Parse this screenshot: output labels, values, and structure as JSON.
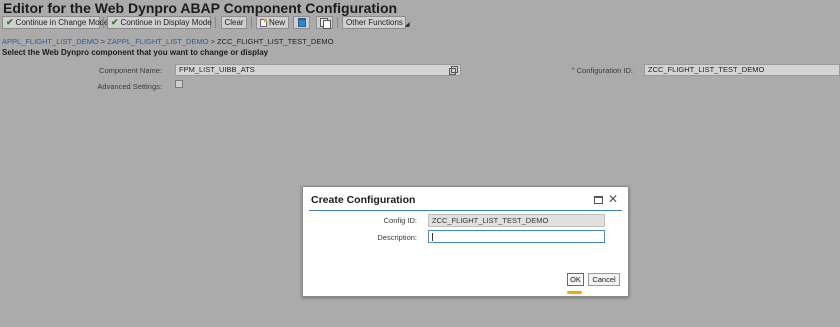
{
  "window": {
    "title": "Editor for the Web Dynpro ABAP Component Configuration"
  },
  "toolbar": {
    "change_mode": "Continue in Change Mode",
    "display_mode": "Continue in Display Mode",
    "clear": "Clear",
    "new": "New",
    "other_functions": "Other Functions",
    "icons": [
      "checkmark-icon",
      "checkmark-icon",
      "new-document-icon",
      "delete-icon",
      "copy-icon"
    ]
  },
  "breadcrumb": {
    "items": [
      "APPL_FLIGHT_LIST_DEMO",
      "ZAPPL_FLIGHT_LIST_DEMO",
      "ZCC_FLIGHT_LIST_TEST_DEMO"
    ],
    "separator": ">"
  },
  "main": {
    "subtitle": "Select the Web Dynpro component that you want to change or display",
    "component_label": "Component Name:",
    "component_value": "FPM_LIST_UIBB_ATS",
    "config_label": "Configuration ID:",
    "config_required": "*",
    "config_value": "ZCC_FLIGHT_LIST_TEST_DEMO",
    "advanced_label": "Advanced Settings:",
    "advanced_checked": false
  },
  "dialog": {
    "title": "Create Configuration",
    "config_label": "Config ID:",
    "config_value": "ZCC_FLIGHT_LIST_TEST_DEMO",
    "description_label": "Description:",
    "description_value": "",
    "ok": "OK",
    "cancel": "Cancel"
  },
  "colors": {
    "background": "#ababab",
    "link": "#2a5d99",
    "accent": "#3c86c4",
    "focus": "#f0ab00"
  }
}
